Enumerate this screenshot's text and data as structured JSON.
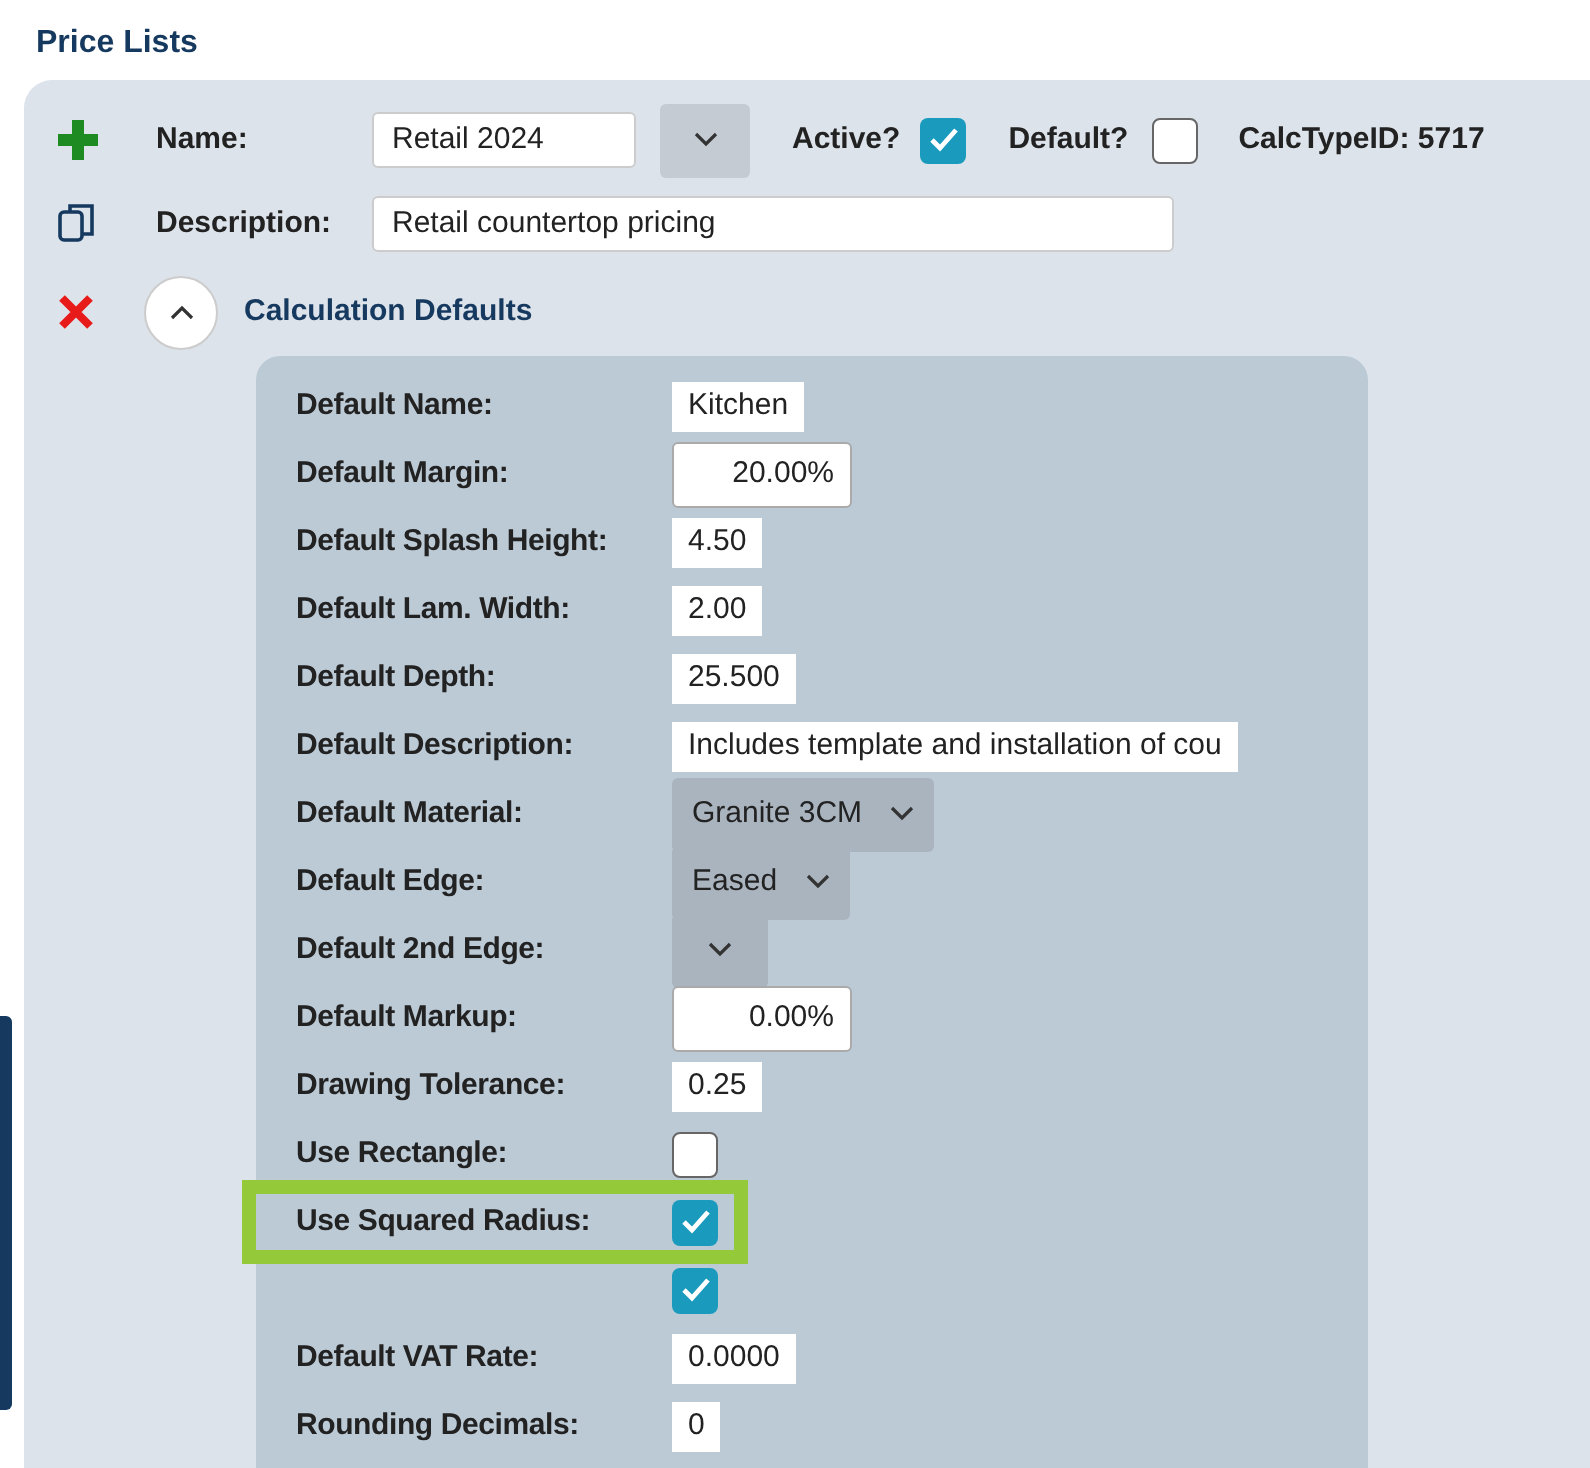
{
  "title": "Price Lists",
  "header": {
    "name_label": "Name:",
    "name_value": "Retail 2024",
    "active_label": "Active?",
    "active_checked": true,
    "default_label": "Default?",
    "default_checked": false,
    "calc_type": "CalcTypeID: 5717",
    "description_label": "Description:",
    "description_value": "Retail countertop pricing"
  },
  "section": {
    "title": "Calculation Defaults",
    "expanded": true
  },
  "fields": [
    {
      "kind": "text",
      "label": "Default Name:",
      "value": "Kitchen"
    },
    {
      "kind": "percent",
      "label": "Default Margin:",
      "value": "20.00%"
    },
    {
      "kind": "text",
      "label": "Default Splash Height:",
      "value": "4.50"
    },
    {
      "kind": "text",
      "label": "Default Lam. Width:",
      "value": "2.00"
    },
    {
      "kind": "text",
      "label": "Default Depth:",
      "value": "25.500"
    },
    {
      "kind": "text",
      "label": "Default Description:",
      "value": "Includes template and installation of cou"
    },
    {
      "kind": "select",
      "label": "Default Material:",
      "value": "Granite 3CM"
    },
    {
      "kind": "select",
      "label": "Default Edge:",
      "value": "Eased"
    },
    {
      "kind": "select",
      "label": "Default 2nd Edge:"
    },
    {
      "kind": "percent",
      "label": "Default Markup:",
      "value": "0.00%"
    },
    {
      "kind": "text",
      "label": "Drawing Tolerance:",
      "value": "0.25"
    },
    {
      "kind": "checkbox",
      "label": "Use Rectangle:",
      "checked": false
    },
    {
      "kind": "checkbox",
      "label": "Use Squared Radius:",
      "checked": true
    },
    {
      "kind": "checkbox",
      "checked": true
    },
    {
      "kind": "text",
      "label": "Default VAT Rate:",
      "value": "0.0000"
    },
    {
      "kind": "text",
      "label": "Rounding Decimals:",
      "value": "0"
    }
  ]
}
